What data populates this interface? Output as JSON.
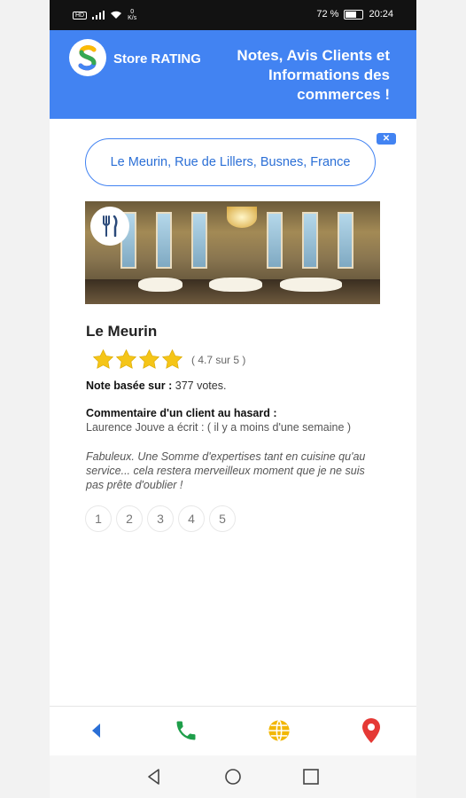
{
  "status_bar": {
    "sim": "HD",
    "net_speed_value": "0",
    "net_speed_unit": "K/s",
    "battery": "72 %",
    "time": "20:24"
  },
  "header": {
    "brand_prefix": "Store",
    "brand_strong": "RATING",
    "tagline": "Notes, Avis Clients et Informations des commerces !"
  },
  "search": {
    "value": "Le Meurin, Rue de Lillers, Busnes, France",
    "clear_label": "✕"
  },
  "place": {
    "name": "Le Meurin",
    "stars_filled": 4,
    "stars_total": 5,
    "rating_text": "( 4.7 sur 5 )",
    "based_label": "Note basée sur :",
    "based_value": "377 votes."
  },
  "review": {
    "title": "Commentaire d'un client au hasard :",
    "author_line": "Laurence Jouve a écrit : ( il y a moins d'une semaine )",
    "body": "Fabuleux. Une Somme d'expertises tant en cuisine qu'au service... cela restera merveilleux moment que je ne suis pas prête d'oublier !"
  },
  "pagination": [
    "1",
    "2",
    "3",
    "4",
    "5"
  ],
  "bottom_bar": {
    "icons": [
      "back-arrow-icon",
      "phone-icon",
      "globe-icon",
      "map-pin-icon"
    ]
  },
  "colors": {
    "header": "#4283f2",
    "accent_blue": "#2b6fd6",
    "star": "#f5c518",
    "phone": "#1e9e4a",
    "globe": "#f2b705",
    "pin": "#e53935"
  }
}
